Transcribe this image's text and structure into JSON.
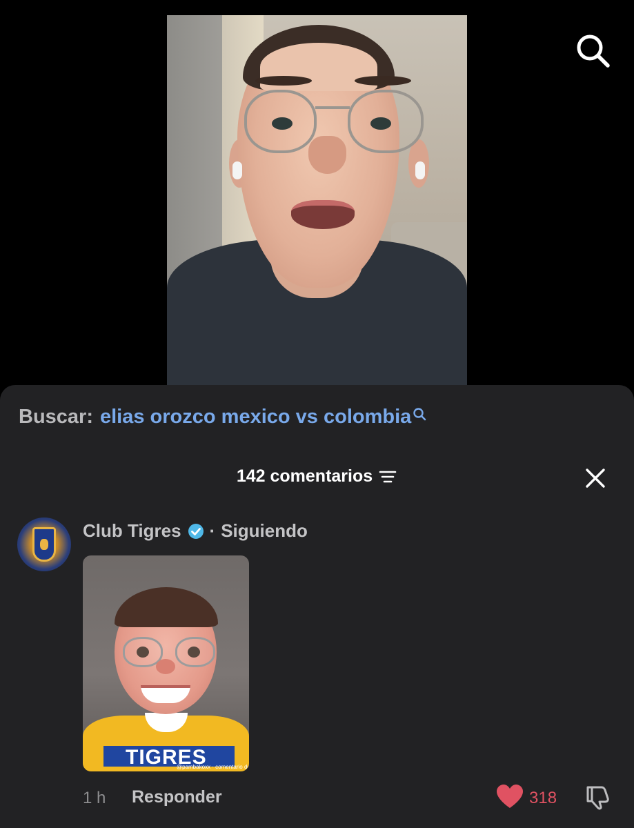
{
  "video": {
    "description_icon": "person-video-thumbnail"
  },
  "top_bar": {
    "search_icon": "search-icon"
  },
  "search_suggestion": {
    "label": "Buscar:",
    "query": "elias orozco mexico vs colombia",
    "icon": "search-icon"
  },
  "comments_header": {
    "title": "142 comentarios",
    "sort_icon": "sort-icon",
    "close_icon": "close-icon"
  },
  "comment": {
    "author": "Club Tigres",
    "verified": true,
    "separator": "·",
    "follow_status": "Siguiendo",
    "sticker": {
      "shirt_text": "TIGRES",
      "watermark": "@pambakoxx · comentario de TikTok"
    },
    "time": "1 h",
    "reply_label": "Responder",
    "like_count": "318"
  },
  "colors": {
    "background": "#000000",
    "sheet": "#222224",
    "link_blue": "#79a9ea",
    "like_red": "#e05262",
    "verified_blue": "#4fb8e8"
  }
}
